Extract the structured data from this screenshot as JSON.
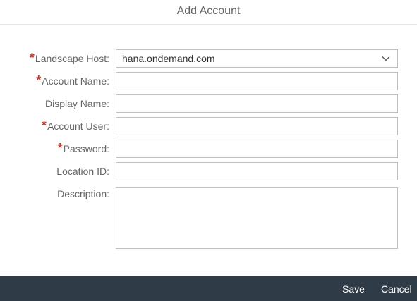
{
  "dialog": {
    "title": "Add Account"
  },
  "form": {
    "landscape_host": {
      "label": "Landscape Host:",
      "required": "*",
      "value": "hana.ondemand.com"
    },
    "account_name": {
      "label": "Account Name:",
      "required": "*",
      "value": ""
    },
    "display_name": {
      "label": "Display Name:",
      "value": ""
    },
    "account_user": {
      "label": "Account User:",
      "required": "*",
      "value": ""
    },
    "password": {
      "label": "Password:",
      "required": "*",
      "value": ""
    },
    "location_id": {
      "label": "Location ID:",
      "value": ""
    },
    "description": {
      "label": "Description:",
      "value": ""
    }
  },
  "footer": {
    "save_label": "Save",
    "cancel_label": "Cancel"
  },
  "icons": {
    "dropdown": "chevron-down-icon"
  },
  "colors": {
    "required_marker": "#c0392b",
    "footer_background": "#2f3c48",
    "field_border": "#bfbfbf"
  }
}
